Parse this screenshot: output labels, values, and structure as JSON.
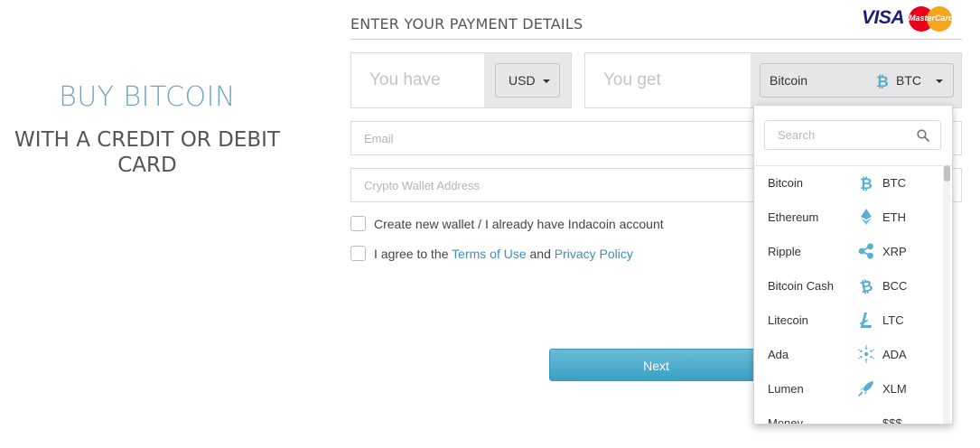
{
  "hero": {
    "title": "BUY BITCOIN",
    "subtitle": "WITH A CREDIT OR DEBIT CARD"
  },
  "payment": {
    "header": "ENTER YOUR PAYMENT DETAILS",
    "logos": {
      "visa": "VISA",
      "mastercard": "MasterCard"
    },
    "you_have": {
      "placeholder": "You have",
      "currency": "USD"
    },
    "you_get": {
      "placeholder": "You get",
      "currency_name": "Bitcoin",
      "currency_code": "BTC"
    },
    "email_placeholder": "Email",
    "wallet_placeholder": "Crypto Wallet Address",
    "checkbox_wallet": "Create new wallet / I already have Indacoin account",
    "agree_prefix": "I agree to the",
    "terms_link": "Terms of Use",
    "agree_and": "and",
    "privacy_link": "Privacy Policy",
    "next_label": "Next"
  },
  "dropdown": {
    "search_placeholder": "Search",
    "items": [
      {
        "name": "Bitcoin",
        "code": "BTC",
        "icon": "bitcoin-icon"
      },
      {
        "name": "Ethereum",
        "code": "ETH",
        "icon": "ethereum-icon"
      },
      {
        "name": "Ripple",
        "code": "XRP",
        "icon": "ripple-icon"
      },
      {
        "name": "Bitcoin Cash",
        "code": "BCC",
        "icon": "bitcoin-cash-icon"
      },
      {
        "name": "Litecoin",
        "code": "LTC",
        "icon": "litecoin-icon"
      },
      {
        "name": "Ada",
        "code": "ADA",
        "icon": "cardano-icon"
      },
      {
        "name": "Lumen",
        "code": "XLM",
        "icon": "stellar-rocket-icon"
      },
      {
        "name": "Money",
        "code": "$$$",
        "icon": ""
      }
    ]
  },
  "colors": {
    "accent": "#3b8fc8",
    "hero_title": "#6fa6c6",
    "coin_icon": "#5aaed0",
    "button": "#4aaccc"
  }
}
